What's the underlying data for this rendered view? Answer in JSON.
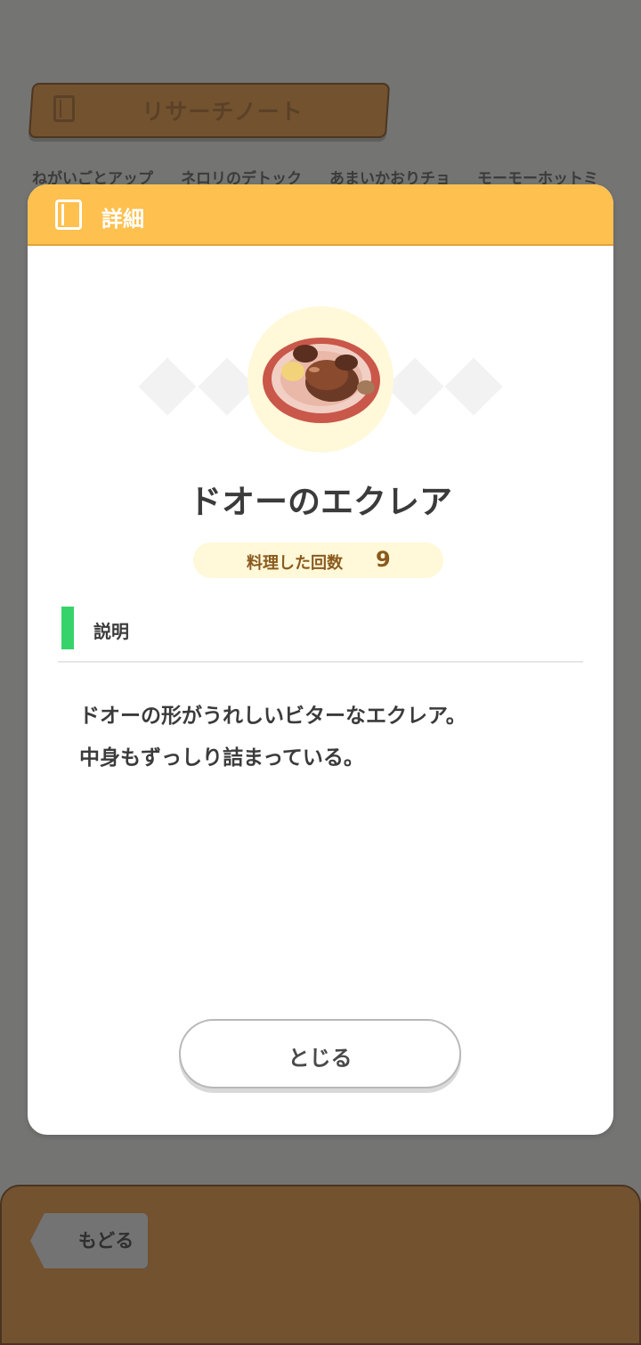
{
  "background": {
    "tab_title": "リサーチノート",
    "chips": [
      "ねがいごとアップ",
      "ネロリのデトック",
      "あまいかおりチョ",
      "モーモーホットミ"
    ],
    "back_label": "もどる"
  },
  "modal": {
    "header_title": "詳細",
    "icon": "book-icon",
    "food_name": "ドオーのエクレア",
    "count_label": "料理した回数",
    "count_value": "9",
    "section_title": "説明",
    "description": [
      "ドオーの形がうれしいビターなエクレア。",
      "中身もずっしり詰まっている。"
    ],
    "close_label": "とじる"
  },
  "colors": {
    "header": "#fec04f",
    "accent_green": "#35d36a",
    "pill": "#fff8d9",
    "footer": "#735230"
  }
}
